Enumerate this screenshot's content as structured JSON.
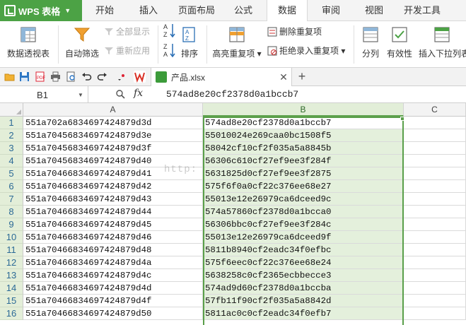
{
  "app": {
    "name": "WPS 表格",
    "brand_color": "#4ca245"
  },
  "menu": {
    "tabs": [
      {
        "label": "开始",
        "active": false
      },
      {
        "label": "插入",
        "active": false
      },
      {
        "label": "页面布局",
        "active": false
      },
      {
        "label": "公式",
        "active": false
      },
      {
        "label": "数据",
        "active": true
      },
      {
        "label": "审阅",
        "active": false
      },
      {
        "label": "视图",
        "active": false
      },
      {
        "label": "开发工具",
        "active": false
      }
    ]
  },
  "ribbon": {
    "pivot": "数据透视表",
    "autofilter": "自动筛选",
    "show_all": "全部显示",
    "reapply": "重新应用",
    "sort_asc": "A↓Z",
    "sort_desc": "Z↓A",
    "sort": "排序",
    "highlight_dup": "高亮重复项",
    "remove_dup": "删除重复项",
    "reject_dup": "拒绝录入重复项",
    "split": "分列",
    "validation": "有效性",
    "dropdown_list": "插入下拉列表"
  },
  "doc_tab": {
    "name": "产品.xlsx"
  },
  "formula_bar": {
    "name_box": "B1",
    "fx": "fx",
    "value": "574ad8e20cf2378d0a1bccb7"
  },
  "grid": {
    "columns": [
      "A",
      "B",
      "C"
    ],
    "watermark": "http:",
    "rows": [
      {
        "n": "1",
        "a": "551a702a6834697424879d3d",
        "b": "574ad8e20cf2378d0a1bccb7"
      },
      {
        "n": "2",
        "a": "551a70456834697424879d3e",
        "b": "55010024e269caa0bc1508f5"
      },
      {
        "n": "3",
        "a": "551a70456834697424879d3f",
        "b": "58042cf10cf2f035a5a8845b"
      },
      {
        "n": "4",
        "a": "551a70456834697424879d40",
        "b": "56306c610cf27ef9ee3f284f"
      },
      {
        "n": "5",
        "a": "551a70466834697424879d41",
        "b": "5631825d0cf27ef9ee3f2875"
      },
      {
        "n": "6",
        "a": "551a70466834697424879d42",
        "b": "575f6f0a0cf22c376ee68e27"
      },
      {
        "n": "7",
        "a": "551a70466834697424879d43",
        "b": "55013e12e26979ca6dceed9c"
      },
      {
        "n": "8",
        "a": "551a70466834697424879d44",
        "b": "574a57860cf2378d0a1bcca0"
      },
      {
        "n": "9",
        "a": "551a70466834697424879d45",
        "b": "56306bbc0cf27ef9ee3f284c"
      },
      {
        "n": "10",
        "a": "551a70466834697424879d46",
        "b": "55013e12e26979ca6dceed9f"
      },
      {
        "n": "11",
        "a": "551a70466834697424879d48",
        "b": "5811b8940cf2eadc34f0efbc"
      },
      {
        "n": "12",
        "a": "551a70466834697424879d4a",
        "b": "575f6eec0cf22c376ee68e24"
      },
      {
        "n": "13",
        "a": "551a70466834697424879d4c",
        "b": "5638258c0cf2365ecbbecce3"
      },
      {
        "n": "14",
        "a": "551a70466834697424879d4d",
        "b": "574ad9d60cf2378d0a1bccba"
      },
      {
        "n": "15",
        "a": "551a70466834697424879d4f",
        "b": "57fb11f90cf2f035a5a8842d"
      },
      {
        "n": "16",
        "a": "551a70466834697424879d50",
        "b": "5811ac0c0cf2eadc34f0efb7"
      }
    ]
  }
}
